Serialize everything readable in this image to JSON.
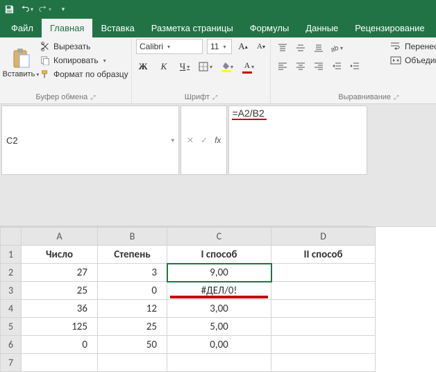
{
  "qat": {
    "save": "save",
    "undo": "undo",
    "redo": "redo"
  },
  "tabs": {
    "file": "Файл",
    "home": "Главная",
    "insert": "Вставка",
    "pagelayout": "Разметка страницы",
    "formulas": "Формулы",
    "data": "Данные",
    "review": "Рецензирование"
  },
  "ribbon": {
    "clipboard": {
      "paste": "Вставить",
      "cut": "Вырезать",
      "copy": "Копировать",
      "format_painter": "Формат по образцу",
      "group": "Буфер обмена"
    },
    "font": {
      "name": "Calibri",
      "size": "11",
      "bold": "Ж",
      "italic": "К",
      "underline": "Ч",
      "group": "Шрифт"
    },
    "alignment": {
      "wrap": "Перенести те",
      "merge": "Объединить и",
      "group": "Выравнивание"
    }
  },
  "namebox": "C2",
  "formula": "=A2/B2",
  "sheet": {
    "cols": [
      "A",
      "B",
      "C",
      "D"
    ],
    "rows": [
      "1",
      "2",
      "3",
      "4",
      "5",
      "6",
      "7"
    ],
    "headers": {
      "A": "Число",
      "B": "Степень",
      "C": "I способ",
      "D": "II способ"
    },
    "data": [
      {
        "A": "27",
        "B": "3",
        "C": "9,00"
      },
      {
        "A": "25",
        "B": "0",
        "C": "#ДЕЛ/0!"
      },
      {
        "A": "36",
        "B": "12",
        "C": "3,00"
      },
      {
        "A": "125",
        "B": "25",
        "C": "5,00"
      },
      {
        "A": "0",
        "B": "50",
        "C": "0,00"
      }
    ]
  }
}
